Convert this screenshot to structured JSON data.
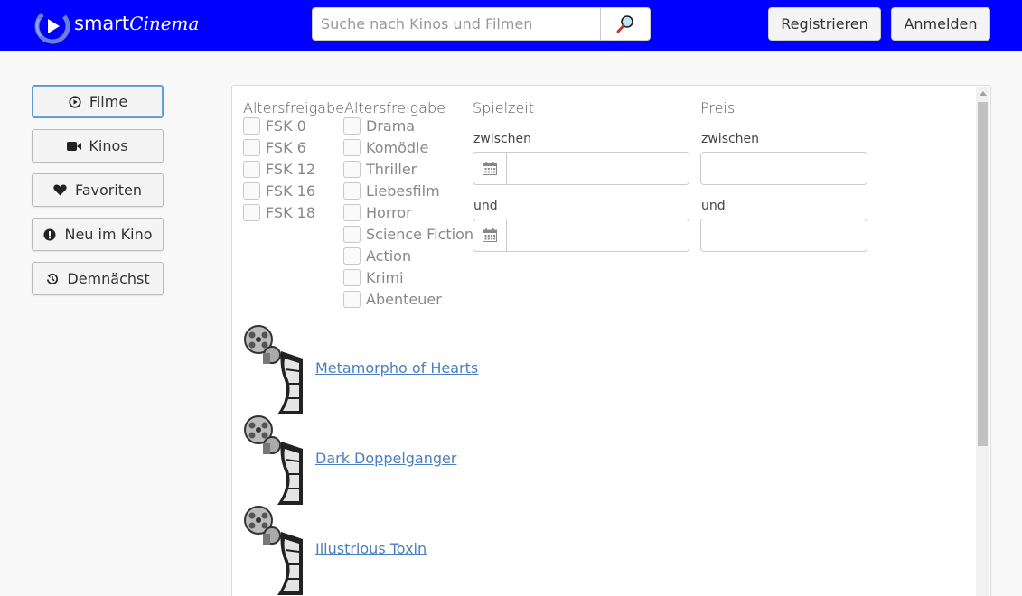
{
  "header": {
    "logo_text_a": "smart",
    "logo_text_b": "Cinema",
    "search_placeholder": "Suche nach Kinos und Filmen",
    "search_icon": "magnifier-icon",
    "register_label": "Registrieren",
    "login_label": "Anmelden",
    "brand_color": "#0000ff"
  },
  "sidebar": {
    "items": [
      {
        "label": "Filme",
        "icon": "play-circle-icon",
        "active": true
      },
      {
        "label": "Kinos",
        "icon": "video-camera-icon",
        "active": false
      },
      {
        "label": "Favoriten",
        "icon": "heart-icon",
        "active": false
      },
      {
        "label": "Neu im Kino",
        "icon": "exclamation-icon",
        "active": false
      },
      {
        "label": "Demnächst",
        "icon": "history-icon",
        "active": false
      }
    ]
  },
  "filters": {
    "age": {
      "title": "Altersfreigabe",
      "options": [
        "FSK 0",
        "FSK 6",
        "FSK 12",
        "FSK 16",
        "FSK 18"
      ]
    },
    "genre": {
      "title": "Altersfreigabe",
      "options": [
        "Drama",
        "Komödie",
        "Thriller",
        "Liebesfilm",
        "Horror",
        "Science Fiction",
        "Action",
        "Krimi",
        "Abenteuer"
      ]
    },
    "showtime": {
      "title": "Spielzeit",
      "from_label": "zwischen",
      "to_label": "und",
      "from_value": "",
      "to_value": ""
    },
    "price": {
      "title": "Preis",
      "from_label": "zwischen",
      "to_label": "und",
      "from_value": "",
      "to_value": ""
    }
  },
  "movies": [
    {
      "title": "Metamorpho of Hearts"
    },
    {
      "title": "Dark Doppelganger"
    },
    {
      "title": "Illustrious Toxin"
    }
  ]
}
